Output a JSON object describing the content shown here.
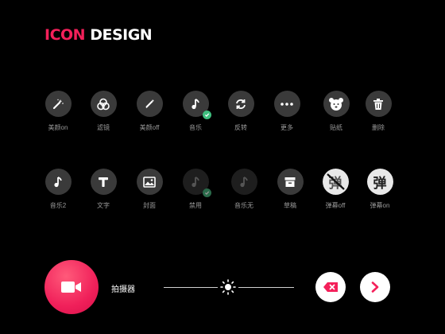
{
  "title": {
    "accent": "ICON",
    "plain": "DESIGN"
  },
  "row1": [
    {
      "label": "美颜on",
      "icon": "magic-wand-icon"
    },
    {
      "label": "滤镜",
      "icon": "filter-icon"
    },
    {
      "label": "美颜off",
      "icon": "pen-icon"
    },
    {
      "label": "音乐",
      "icon": "music-icon"
    },
    {
      "label": "反转",
      "icon": "flip-icon"
    },
    {
      "label": "更多",
      "icon": "more-icon"
    },
    {
      "label": "贴纸",
      "icon": "sticker-icon"
    },
    {
      "label": "删除",
      "icon": "trash-icon"
    }
  ],
  "row2": [
    {
      "label": "音乐2",
      "icon": "music-icon"
    },
    {
      "label": "文字",
      "icon": "text-icon"
    },
    {
      "label": "封面",
      "icon": "cover-icon"
    },
    {
      "label": "禁用",
      "icon": "music-disabled-icon"
    },
    {
      "label": "音乐无",
      "icon": "music-none-icon"
    },
    {
      "label": "草稿",
      "icon": "draft-icon"
    },
    {
      "label": "弹幕off",
      "icon": "danmu-off-icon",
      "glyph": "弹"
    },
    {
      "label": "弹幕on",
      "icon": "danmu-on-icon",
      "glyph": "弹"
    }
  ],
  "bottom": {
    "record_label": "拍摄器"
  },
  "colors": {
    "accent": "#f4205a",
    "check": "#3fbf7f"
  }
}
